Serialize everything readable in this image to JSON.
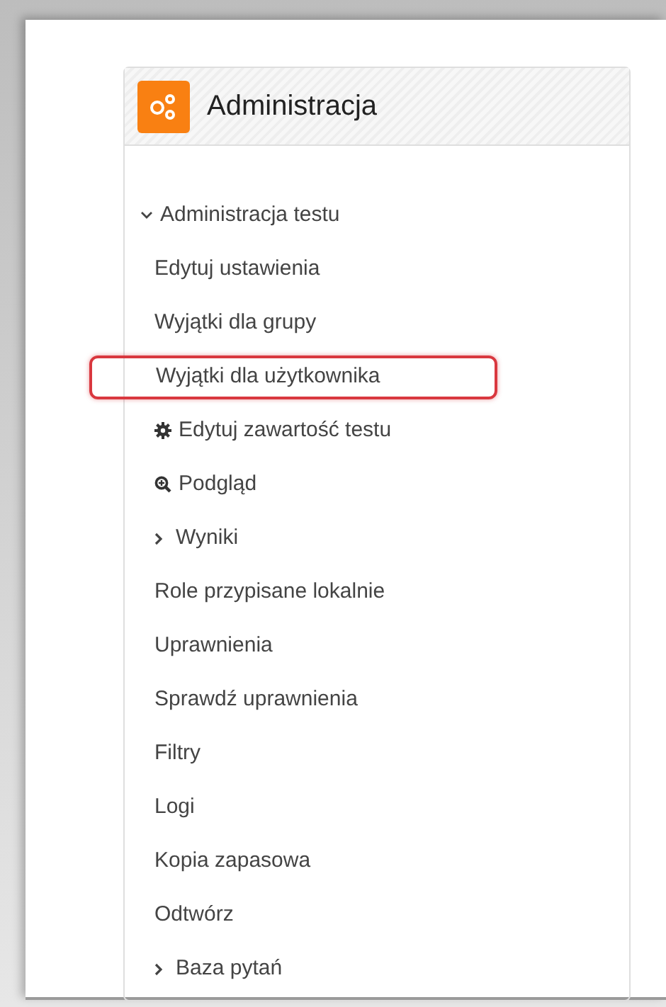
{
  "block": {
    "title": "Administracja",
    "tree": [
      {
        "label": "Administracja testu",
        "kind": "node",
        "expanded": true,
        "highlighted": false,
        "children": [
          {
            "label": "Edytuj ustawienia",
            "kind": "link",
            "highlighted": false
          },
          {
            "label": "Wyjątki dla grupy",
            "kind": "link",
            "highlighted": false
          },
          {
            "label": "Wyjątki dla użytkownika",
            "kind": "link",
            "highlighted": true
          },
          {
            "label": "Edytuj zawartość testu",
            "kind": "gear-link",
            "highlighted": false
          },
          {
            "label": "Podgląd",
            "kind": "preview-link",
            "highlighted": false
          },
          {
            "label": "Wyniki",
            "kind": "node",
            "expanded": false,
            "highlighted": false
          },
          {
            "label": "Role przypisane lokalnie",
            "kind": "link",
            "highlighted": false
          },
          {
            "label": "Uprawnienia",
            "kind": "link",
            "highlighted": false
          },
          {
            "label": "Sprawdź uprawnienia",
            "kind": "link",
            "highlighted": false
          },
          {
            "label": "Filtry",
            "kind": "link",
            "highlighted": false
          },
          {
            "label": "Logi",
            "kind": "link",
            "highlighted": false
          },
          {
            "label": "Kopia zapasowa",
            "kind": "link",
            "highlighted": false
          },
          {
            "label": "Odtwórz",
            "kind": "link",
            "highlighted": false
          },
          {
            "label": "Baza pytań",
            "kind": "node",
            "expanded": false,
            "highlighted": false
          }
        ]
      }
    ]
  }
}
